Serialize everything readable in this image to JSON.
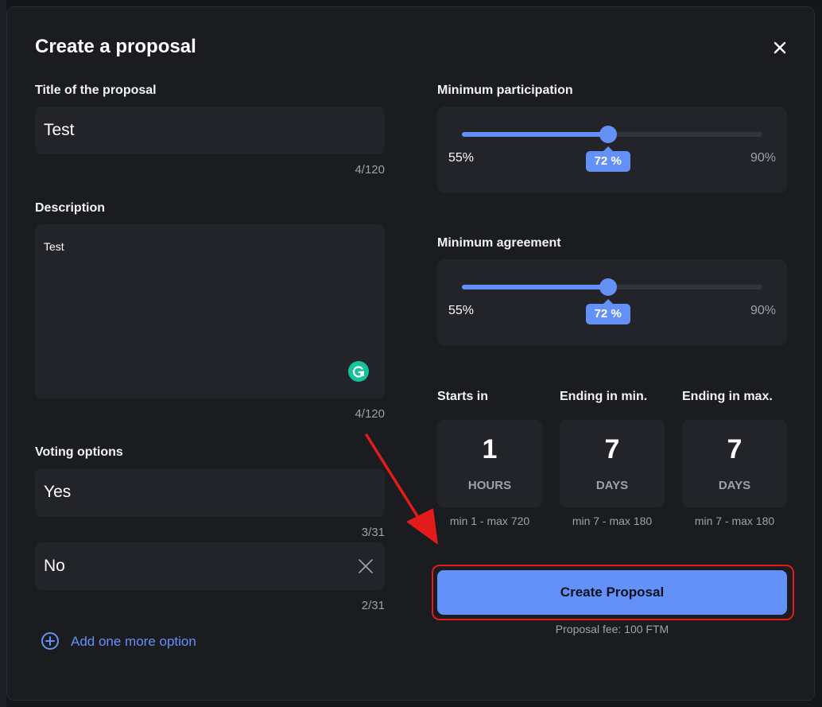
{
  "modal": {
    "title": "Create a proposal"
  },
  "left": {
    "title_label": "Title of the proposal",
    "title_value": "Test",
    "title_counter": "4/120",
    "description_label": "Description",
    "description_value": "Test",
    "description_counter": "4/120",
    "voting_label": "Voting options",
    "options": [
      {
        "value": "Yes",
        "counter": "3/31"
      },
      {
        "value": "No",
        "counter": "2/31"
      }
    ],
    "add_option_label": "Add one more option"
  },
  "right": {
    "participation": {
      "label": "Minimum participation",
      "min_label": "55%",
      "max_label": "90%",
      "value_label": "72 %",
      "value_fraction": 0.486
    },
    "agreement": {
      "label": "Minimum agreement",
      "min_label": "55%",
      "max_label": "90%",
      "value_label": "72 %",
      "value_fraction": 0.486
    },
    "timing": [
      {
        "label": "Starts in",
        "value": "1",
        "unit": "HOURS",
        "range": "min 1 - max 720"
      },
      {
        "label": "Ending in min.",
        "value": "7",
        "unit": "DAYS",
        "range": "min 7 - max 180"
      },
      {
        "label": "Ending in max.",
        "value": "7",
        "unit": "DAYS",
        "range": "min 7 - max 180"
      }
    ],
    "create_button": "Create Proposal",
    "fee": "Proposal fee: 100 FTM"
  },
  "colors": {
    "accent": "#6391f7",
    "annotation": "#e31b1b",
    "grammarly": "#15c39a"
  },
  "icons": [
    "close-icon",
    "grammarly-icon",
    "clear-option-icon",
    "plus-circle-icon"
  ]
}
